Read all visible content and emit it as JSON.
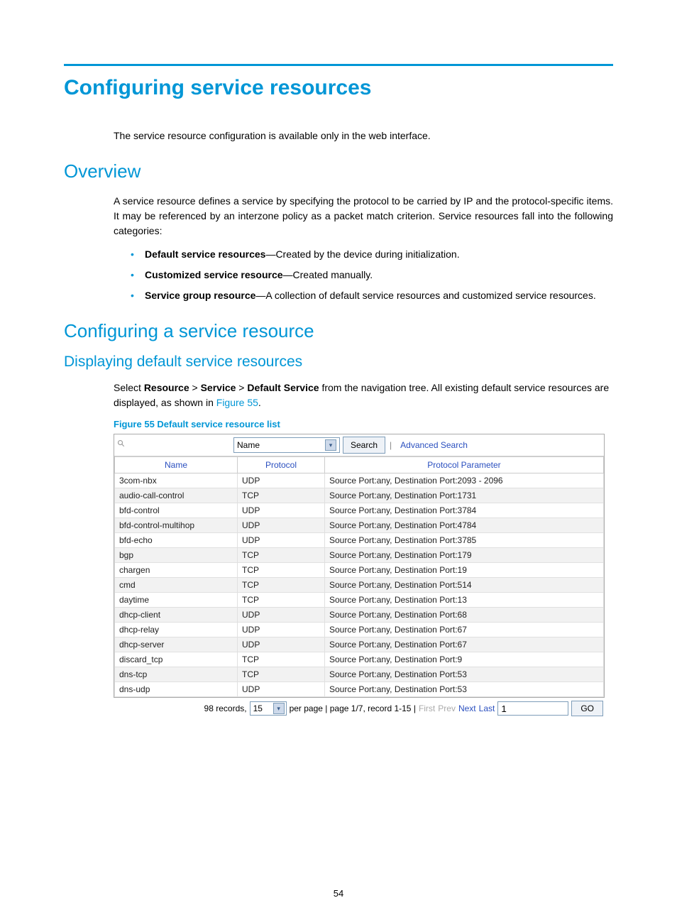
{
  "title": "Configuring service resources",
  "intro": "The service resource configuration is available only in the web interface.",
  "overview_heading": "Overview",
  "overview_para": "A service resource defines a service by specifying the protocol to be carried by IP and the protocol-specific items. It may be referenced by an interzone policy as a packet match criterion. Service resources fall into the following categories:",
  "bullets": [
    {
      "bold": "Default service resources",
      "rest": "—Created by the device during initialization."
    },
    {
      "bold": "Customized service resource",
      "rest": "—Created manually."
    },
    {
      "bold": "Service group resource",
      "rest": "—A collection of default service resources and customized service resources."
    }
  ],
  "config_heading": "Configuring a service resource",
  "display_heading": "Displaying default service resources",
  "breadcrumb": {
    "prefix": "Select ",
    "b1": "Resource",
    "gt1": " > ",
    "b2": "Service",
    "gt2": " > ",
    "b3": "Default Service",
    "rest": " from the navigation tree. All existing default service resources are displayed, as shown in ",
    "figref": "Figure 55",
    "period": "."
  },
  "fig_caption": "Figure 55 Default service resource list",
  "search": {
    "field_select": "Name",
    "button": "Search",
    "advanced": "Advanced Search"
  },
  "table": {
    "headers": {
      "name": "Name",
      "protocol": "Protocol",
      "param": "Protocol Parameter"
    },
    "rows": [
      {
        "name": "3com-nbx",
        "protocol": "UDP",
        "param": "Source Port:any, Destination Port:2093 - 2096"
      },
      {
        "name": "audio-call-control",
        "protocol": "TCP",
        "param": "Source Port:any, Destination Port:1731"
      },
      {
        "name": "bfd-control",
        "protocol": "UDP",
        "param": "Source Port:any, Destination Port:3784"
      },
      {
        "name": "bfd-control-multihop",
        "protocol": "UDP",
        "param": "Source Port:any, Destination Port:4784"
      },
      {
        "name": "bfd-echo",
        "protocol": "UDP",
        "param": "Source Port:any, Destination Port:3785"
      },
      {
        "name": "bgp",
        "protocol": "TCP",
        "param": "Source Port:any, Destination Port:179"
      },
      {
        "name": "chargen",
        "protocol": "TCP",
        "param": "Source Port:any, Destination Port:19"
      },
      {
        "name": "cmd",
        "protocol": "TCP",
        "param": "Source Port:any, Destination Port:514"
      },
      {
        "name": "daytime",
        "protocol": "TCP",
        "param": "Source Port:any, Destination Port:13"
      },
      {
        "name": "dhcp-client",
        "protocol": "UDP",
        "param": "Source Port:any, Destination Port:68"
      },
      {
        "name": "dhcp-relay",
        "protocol": "UDP",
        "param": "Source Port:any, Destination Port:67"
      },
      {
        "name": "dhcp-server",
        "protocol": "UDP",
        "param": "Source Port:any, Destination Port:67"
      },
      {
        "name": "discard_tcp",
        "protocol": "TCP",
        "param": "Source Port:any, Destination Port:9"
      },
      {
        "name": "dns-tcp",
        "protocol": "TCP",
        "param": "Source Port:any, Destination Port:53"
      },
      {
        "name": "dns-udp",
        "protocol": "UDP",
        "param": "Source Port:any, Destination Port:53"
      }
    ]
  },
  "pager": {
    "records": "98 records,",
    "per_page_value": "15",
    "per_page_text": "per page | page 1/7, record 1-15 |",
    "first": "First",
    "prev": "Prev",
    "next": "Next",
    "last": "Last",
    "page_input": "1",
    "go": "GO"
  },
  "page_number": "54"
}
